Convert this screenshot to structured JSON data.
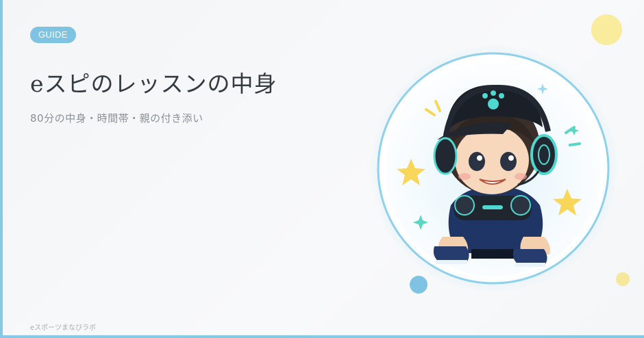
{
  "badge": {
    "label": "GUIDE"
  },
  "header": {
    "title": "eスピのレッスンの中身",
    "subtitle": "80分の中身・時間帯・親の付き添い"
  },
  "footer": {
    "brand": "eスポーツまなびラボ"
  },
  "illustration": {
    "subject": "boy-gamer-with-headset-and-controller-icon"
  },
  "colors": {
    "accent": "#7fc3e3",
    "title": "#333a40",
    "subtitle": "#8a9096",
    "dot_yellow": "#f9ec9c"
  }
}
